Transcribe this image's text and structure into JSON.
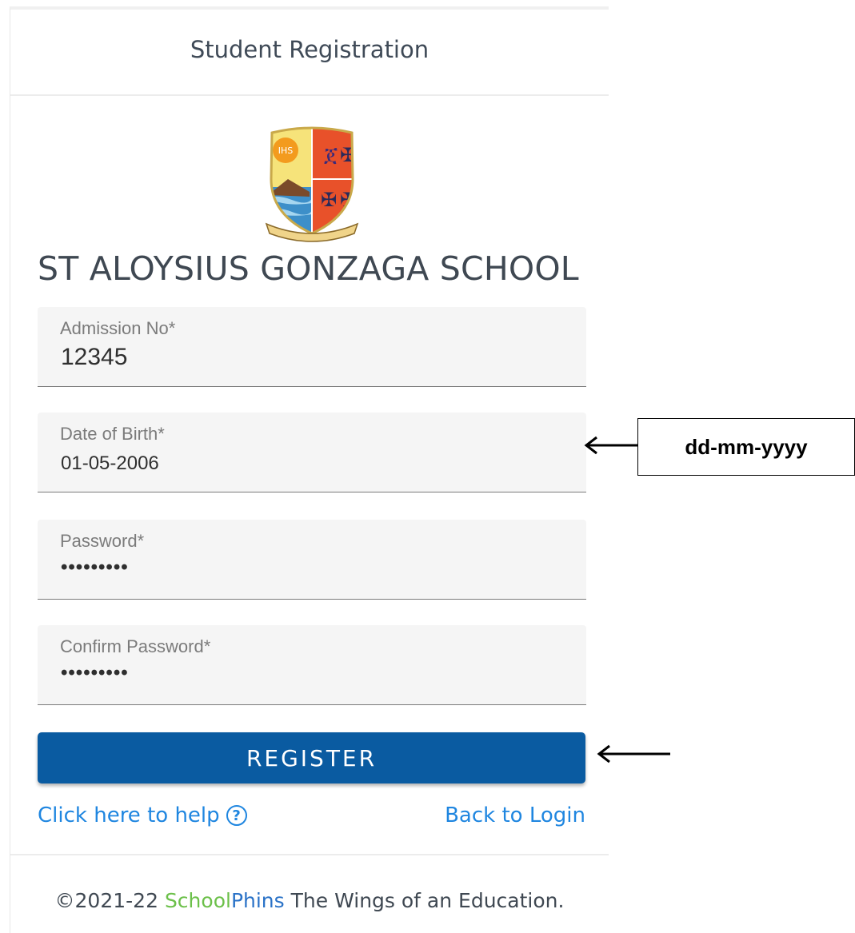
{
  "header": {
    "title": "Student Registration"
  },
  "school": {
    "name": "ST ALOYSIUS GONZAGA SCHOOL",
    "logo_text": "IHS"
  },
  "form": {
    "admission": {
      "label": "Admission No*",
      "value": "12345"
    },
    "dob": {
      "label": "Date of Birth*",
      "value": "01-05-2006"
    },
    "password": {
      "label": "Password*",
      "value": "•••••••••"
    },
    "confirm": {
      "label": "Confirm Password*",
      "value": "•••••••••"
    },
    "register_label": "REGISTER"
  },
  "links": {
    "help": "Click here to help",
    "help_icon": "?",
    "back": "Back to Login"
  },
  "footer": {
    "prefix": "©2021-22 ",
    "brand_school": "School",
    "brand_phins": "Phins",
    "suffix": " The Wings of an Education."
  },
  "annotation": {
    "dob_hint": "dd-mm-yyyy"
  },
  "colors": {
    "primary": "#0a5ba1",
    "link": "#1f86e0",
    "brand_green": "#6cc04a",
    "brand_blue": "#2a72c7"
  }
}
